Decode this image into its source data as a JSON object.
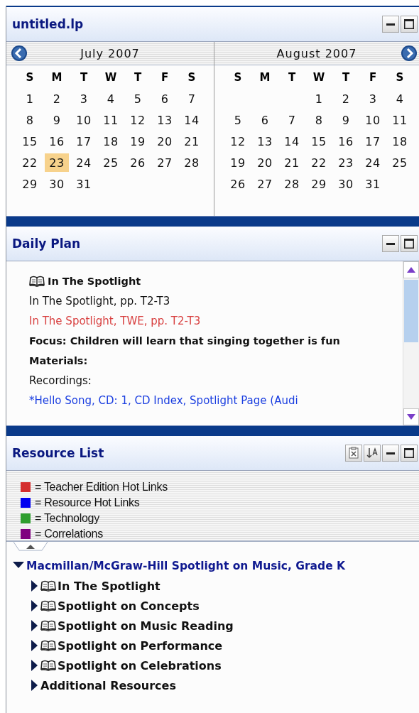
{
  "calendar_panel": {
    "title": "untitled.lp",
    "months": [
      {
        "title": "July 2007",
        "weekdays": [
          "S",
          "M",
          "T",
          "W",
          "T",
          "F",
          "S"
        ],
        "weeks": [
          [
            {
              "d": "1",
              "selected": false
            },
            {
              "d": "2",
              "selected": false
            },
            {
              "d": "3",
              "selected": false
            },
            {
              "d": "4",
              "selected": false
            },
            {
              "d": "5",
              "selected": false
            },
            {
              "d": "6",
              "selected": false
            },
            {
              "d": "7",
              "selected": false
            }
          ],
          [
            {
              "d": "8",
              "selected": false
            },
            {
              "d": "9",
              "selected": false
            },
            {
              "d": "10",
              "selected": false
            },
            {
              "d": "11",
              "selected": false
            },
            {
              "d": "12",
              "selected": false
            },
            {
              "d": "13",
              "selected": false
            },
            {
              "d": "14",
              "selected": false
            }
          ],
          [
            {
              "d": "15",
              "selected": false
            },
            {
              "d": "16",
              "selected": false
            },
            {
              "d": "17",
              "selected": false
            },
            {
              "d": "18",
              "selected": false
            },
            {
              "d": "19",
              "selected": false
            },
            {
              "d": "20",
              "selected": false
            },
            {
              "d": "21",
              "selected": false
            }
          ],
          [
            {
              "d": "22",
              "selected": false
            },
            {
              "d": "23",
              "selected": true
            },
            {
              "d": "24",
              "selected": false
            },
            {
              "d": "25",
              "selected": false
            },
            {
              "d": "26",
              "selected": false
            },
            {
              "d": "27",
              "selected": false
            },
            {
              "d": "28",
              "selected": false
            }
          ],
          [
            {
              "d": "29",
              "selected": false
            },
            {
              "d": "30",
              "selected": false
            },
            {
              "d": "31",
              "selected": false
            }
          ]
        ]
      },
      {
        "title": "August 2007",
        "weekdays": [
          "S",
          "M",
          "T",
          "W",
          "T",
          "F",
          "S"
        ],
        "weeks": [
          [
            {
              "d": "1",
              "selected": false
            },
            {
              "d": "2",
              "selected": false
            },
            {
              "d": "3",
              "selected": false
            },
            {
              "d": "4",
              "selected": false
            }
          ],
          [
            {
              "d": "5",
              "selected": false
            },
            {
              "d": "6",
              "selected": false
            },
            {
              "d": "7",
              "selected": false
            },
            {
              "d": "8",
              "selected": false
            },
            {
              "d": "9",
              "selected": false
            },
            {
              "d": "10",
              "selected": false
            },
            {
              "d": "11",
              "selected": false
            }
          ],
          [
            {
              "d": "12",
              "selected": false
            },
            {
              "d": "13",
              "selected": false
            },
            {
              "d": "14",
              "selected": false
            },
            {
              "d": "15",
              "selected": false
            },
            {
              "d": "16",
              "selected": false
            },
            {
              "d": "17",
              "selected": false
            },
            {
              "d": "18",
              "selected": false
            }
          ],
          [
            {
              "d": "19",
              "selected": false
            },
            {
              "d": "20",
              "selected": false
            },
            {
              "d": "21",
              "selected": false
            },
            {
              "d": "22",
              "selected": false
            },
            {
              "d": "23",
              "selected": false
            },
            {
              "d": "24",
              "selected": false
            },
            {
              "d": "25",
              "selected": false
            }
          ],
          [
            {
              "d": "26",
              "selected": false
            },
            {
              "d": "27",
              "selected": false
            },
            {
              "d": "28",
              "selected": false
            },
            {
              "d": "29",
              "selected": false
            },
            {
              "d": "30",
              "selected": false
            },
            {
              "d": "31",
              "selected": false
            }
          ]
        ]
      }
    ]
  },
  "daily_plan": {
    "title": "Daily Plan",
    "lines": [
      {
        "kind": "heading",
        "text": "In The Spotlight"
      },
      {
        "kind": "text",
        "text": "In The Spotlight, pp. T2-T3"
      },
      {
        "kind": "teacher-link",
        "text": "In The Spotlight, TWE, pp. T2-T3"
      },
      {
        "kind": "bold",
        "text": "Focus: Children will learn that singing together is fun"
      },
      {
        "kind": "bold",
        "text": "Materials:"
      },
      {
        "kind": "text",
        "text": "Recordings:"
      },
      {
        "kind": "resource-link",
        "text": "*Hello Song, CD: 1, CD Index, Spotlight Page (Audi"
      }
    ]
  },
  "resource_list": {
    "title": "Resource List",
    "legend": [
      {
        "color": "#d42e2e",
        "label": "= Teacher Edition Hot Links"
      },
      {
        "color": "#0000f0",
        "label": "= Resource Hot Links"
      },
      {
        "color": "#2e9e2e",
        "label": "= Technology"
      },
      {
        "color": "#800080",
        "label": "= Correlations"
      }
    ],
    "tree": [
      {
        "label": "Macmillan/McGraw-Hill Spotlight on Music, Grade K",
        "expanded": true,
        "children": [
          {
            "kind": "book",
            "label": "In The Spotlight",
            "expanded": false
          },
          {
            "kind": "book",
            "label": "Spotlight on Concepts",
            "expanded": false
          },
          {
            "kind": "book",
            "label": "Spotlight on Music Reading",
            "expanded": false
          },
          {
            "kind": "book",
            "label": "Spotlight on Performance",
            "expanded": false
          },
          {
            "kind": "book",
            "label": "Spotlight on Celebrations",
            "expanded": false
          },
          {
            "kind": "plain",
            "label": "Additional Resources",
            "expanded": false
          }
        ]
      }
    ]
  }
}
